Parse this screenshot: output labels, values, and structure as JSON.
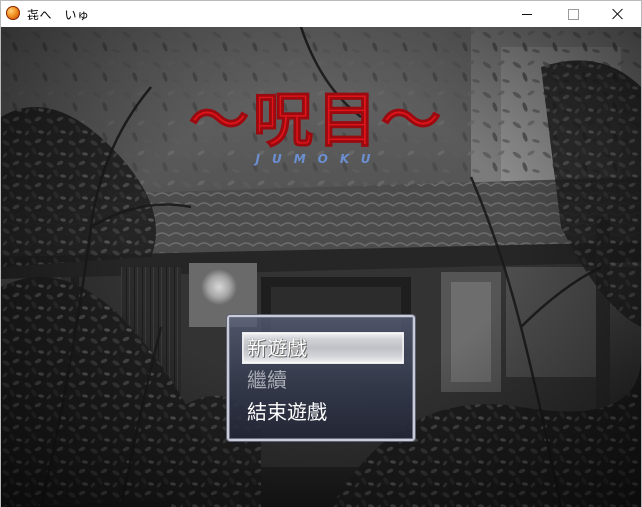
{
  "window": {
    "title": "㐂へ　いゅ",
    "icon": "orange-orb-icon",
    "controls": {
      "minimize_icon": "minimize-icon",
      "maximize_icon": "maximize-icon",
      "close_icon": "close-icon"
    }
  },
  "game": {
    "logo_title": "〜呪目〜",
    "logo_subtitle": "JUMOKU",
    "logo_title_color": "#e0141b",
    "logo_subtitle_color": "#6b8fd0",
    "menu": {
      "items": [
        {
          "label": "新遊戲",
          "selected": true,
          "enabled": true
        },
        {
          "label": "繼續",
          "selected": false,
          "enabled": false
        },
        {
          "label": "結束遊戲",
          "selected": false,
          "enabled": true
        }
      ]
    }
  }
}
